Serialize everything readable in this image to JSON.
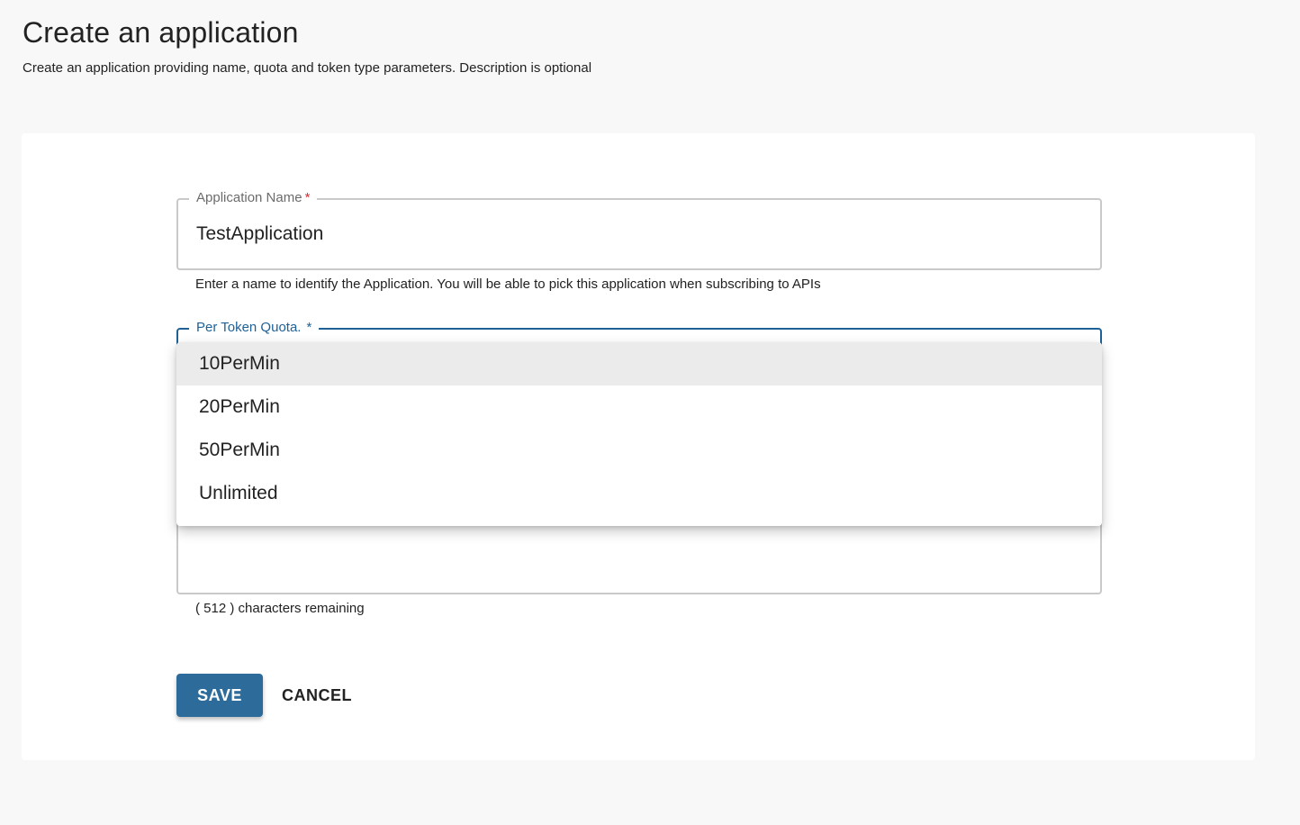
{
  "header": {
    "title": "Create an application",
    "subtitle": "Create an application providing name, quota and token type parameters. Description is optional"
  },
  "form": {
    "application_name": {
      "label": "Application Name",
      "required_mark": "*",
      "value": "TestApplication",
      "helper": "Enter a name to identify the Application. You will be able to pick this application when subscribing to APIs"
    },
    "quota": {
      "label": "Per Token Quota.",
      "required_mark": "*",
      "options": [
        "10PerMin",
        "20PerMin",
        "50PerMin",
        "Unlimited"
      ],
      "highlighted": "10PerMin"
    },
    "description": {
      "helper": "( 512 ) characters remaining"
    },
    "actions": {
      "save_label": "SAVE",
      "cancel_label": "CANCEL"
    }
  },
  "colors": {
    "primary": "#2d6b9a",
    "focus": "#1f6196",
    "required": "#d32f2f",
    "background": "#f8f8f8"
  }
}
